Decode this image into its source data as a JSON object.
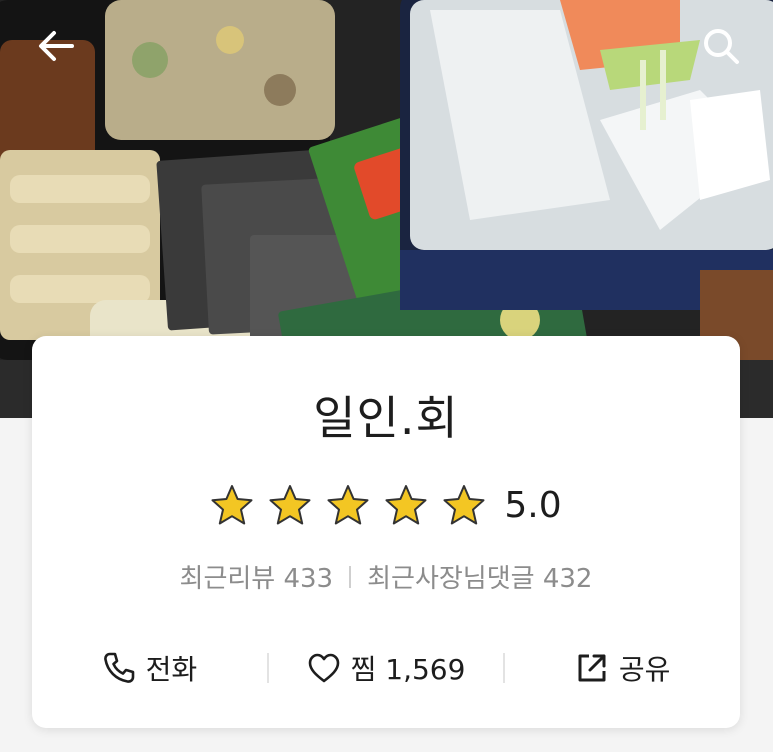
{
  "nav": {
    "back_icon": "arrow-left-icon",
    "search_icon": "search-icon"
  },
  "store": {
    "name": "일인.회",
    "rating": "5.0",
    "stars_filled": 5,
    "stars_total": 5,
    "recent_reviews_label": "최근리뷰 433",
    "owner_comments_label": "최근사장님댓글 432"
  },
  "actions": {
    "call_label": "전화",
    "like_label": "찜 1,569",
    "share_label": "공유"
  },
  "colors": {
    "star_fill": "#f3c623",
    "star_stroke": "#333333",
    "text_primary": "#1d1d1d",
    "text_secondary": "#8c8c8c"
  }
}
